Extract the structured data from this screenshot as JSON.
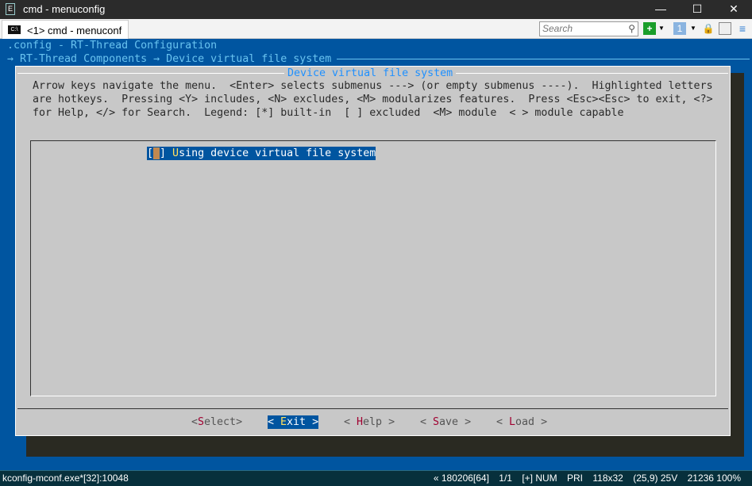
{
  "window": {
    "title": "cmd - menuconfig",
    "minimize": "—",
    "maximize": "☐",
    "close": "✕"
  },
  "tabbar": {
    "tab_label": "<1> cmd - menuconf",
    "search_placeholder": "Search"
  },
  "terminal": {
    "config_title": ".config - RT-Thread Configuration",
    "breadcrumb": "→ RT-Thread Components → Device virtual file system",
    "dialog_title": "Device virtual file system",
    "help_lines": [
      "Arrow keys navigate the menu.  <Enter> selects submenus ---> (or empty submenus ----).  Highlighted letters",
      "are hotkeys.  Pressing <Y> includes, <N> excludes, <M> modularizes features.  Press <Esc><Esc> to exit, <?>",
      "for Help, </> for Search.  Legend: [*] built-in  [ ] excluded  <M> module  < > module capable"
    ],
    "menu_items": [
      {
        "prefix": "[",
        "checkbox": " ",
        "suffix": "] ",
        "hotkey": "U",
        "rest": "sing device virtual file system",
        "checked": false,
        "selected": true
      }
    ],
    "buttons": [
      {
        "open": "<",
        "hotkey": "S",
        "rest": "elect",
        "close": ">",
        "selected": false
      },
      {
        "open": "< ",
        "hotkey": "E",
        "rest": "xit",
        "close": " >",
        "selected": true
      },
      {
        "open": "< ",
        "hotkey": "H",
        "rest": "elp",
        "close": " >",
        "selected": false
      },
      {
        "open": "< ",
        "hotkey": "S",
        "rest": "ave",
        "close": " >",
        "selected": false
      },
      {
        "open": "< ",
        "hotkey": "L",
        "rest": "oad",
        "close": " >",
        "selected": false
      }
    ]
  },
  "statusbar": {
    "process": "kconfig-mconf.exe*[32]:10048",
    "items": [
      "« 180206[64]",
      "1/1",
      "[+] NUM",
      "PRI",
      "118x32",
      "(25,9) 25V",
      "21236 100%"
    ]
  },
  "colors": {
    "terminal_bg": "#0055a0",
    "dialog_bg": "#c8c8c8",
    "hotkey": "#a00030",
    "highlight": "#0055a0"
  }
}
